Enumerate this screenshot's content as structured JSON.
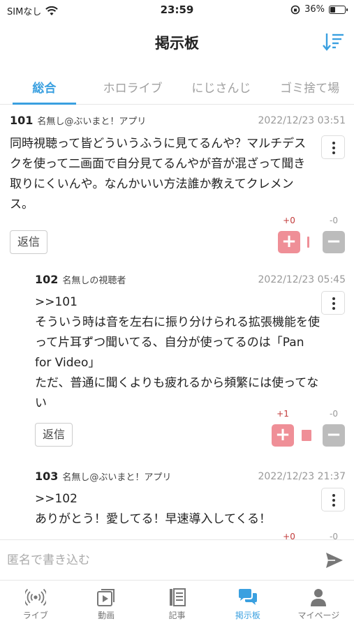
{
  "status_bar": {
    "carrier": "SIMなし",
    "time": "23:59",
    "battery": "36%",
    "battery_level": 0.36
  },
  "header": {
    "title": "掲示板"
  },
  "tabs": [
    {
      "label": "総合",
      "active": true
    },
    {
      "label": "ホロライブ",
      "active": false
    },
    {
      "label": "にじさんじ",
      "active": false
    },
    {
      "label": "ゴミ捨て場",
      "active": false
    }
  ],
  "posts": [
    {
      "number": "101",
      "author": "名無し@ぶいまと！アプリ",
      "date": "2022/12/23 03:51",
      "body": "同時視聴って皆どういうふうに見てるんや？マルチデスクを使って二画面で自分見てるんやが音が混ざって聞き取りにくいんや。なんかいい方法誰か教えてクレメンス。",
      "reply_label": "返信",
      "plus_count": "+0",
      "minus_count": "-0"
    },
    {
      "number": "102",
      "author": "名無しの視聴者",
      "date": "2022/12/23 05:45",
      "body": ">>101\nそういう時は音を左右に振り分けられる拡張機能を使って片耳ずつ聞いてる、自分が使ってるのは「Pan for Video」\nただ、普通に聞くよりも疲れるから頻繁には使ってない",
      "reply_label": "返信",
      "plus_count": "+1",
      "minus_count": "-0"
    },
    {
      "number": "103",
      "author": "名無し@ぶいまと！アプリ",
      "date": "2022/12/23 21:37",
      "body": ">>102\nありがとう！愛してる！早速導入してくる！",
      "plus_count": "+0",
      "minus_count": "-0"
    }
  ],
  "composer": {
    "placeholder": "匿名で書き込む"
  },
  "bottom_nav": [
    {
      "label": "ライブ",
      "icon": "broadcast-icon",
      "active": false
    },
    {
      "label": "動画",
      "icon": "video-play-icon",
      "active": false
    },
    {
      "label": "記事",
      "icon": "article-icon",
      "active": false
    },
    {
      "label": "掲示板",
      "icon": "chat-bubbles-icon",
      "active": true
    },
    {
      "label": "マイページ",
      "icon": "user-icon",
      "active": false
    }
  ],
  "colors": {
    "accent": "#3aa0e0",
    "vote_plus": "#ef8f97",
    "vote_minus": "#bcbcbc",
    "plus_count_text": "#c23a3a"
  }
}
